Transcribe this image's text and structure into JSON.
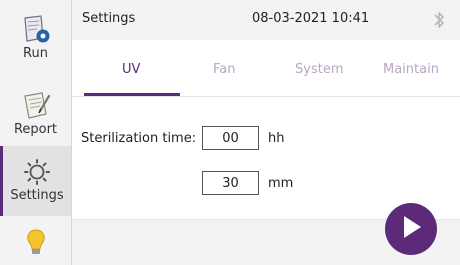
{
  "sidebar": {
    "items": [
      {
        "label": "Run",
        "icon": "run-icon"
      },
      {
        "label": "Report",
        "icon": "report-icon"
      },
      {
        "label": "Settings",
        "icon": "settings-icon",
        "active": true
      },
      {
        "label": "",
        "icon": "lightbulb-icon"
      }
    ]
  },
  "header": {
    "title": "Settings",
    "datetime": "08-03-2021 10:41",
    "icon": "bluetooth-icon"
  },
  "tabs": [
    {
      "label": "UV",
      "active": true
    },
    {
      "label": "Fan"
    },
    {
      "label": "System"
    },
    {
      "label": "Maintain"
    }
  ],
  "uv": {
    "sterilization_label": "Sterilization time:",
    "hours_value": "00",
    "hours_unit": "hh",
    "minutes_value": "30",
    "minutes_unit": "mm"
  },
  "actions": {
    "play_icon": "play-icon"
  },
  "colors": {
    "accent": "#5b2a7a",
    "tab_inactive": "#b7a6c3",
    "sidebar_bg": "#f3f3f3"
  }
}
